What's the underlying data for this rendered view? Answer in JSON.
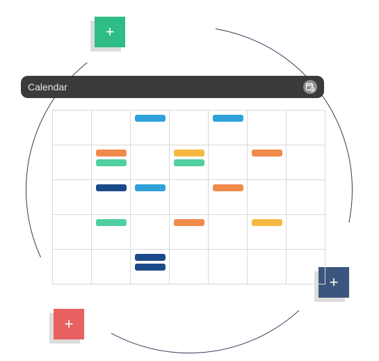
{
  "header": {
    "title": "Calendar",
    "icon": "calendar-add-icon"
  },
  "tiles": {
    "green": {
      "glyph": "+",
      "color": "#2ebd85",
      "shadow": "#9e9e9e"
    },
    "blue": {
      "glyph": "+",
      "color": "#3c557e",
      "shadow": "#9e9e9e"
    },
    "red": {
      "glyph": "+",
      "color": "#e86060",
      "shadow": "#9e9e9e"
    }
  },
  "colors": {
    "blue": "#2ea1d9",
    "green": "#4fd0a1",
    "orange": "#f08a4b",
    "darkblue": "#1b4a8a",
    "yellow": "#f5b941",
    "border": "#d9d9d9"
  },
  "grid": {
    "rows": 5,
    "cols": 7,
    "events": [
      {
        "r": 0,
        "c": 2,
        "color": "blue"
      },
      {
        "r": 0,
        "c": 4,
        "color": "blue"
      },
      {
        "r": 1,
        "c": 1,
        "color": "orange"
      },
      {
        "r": 1,
        "c": 1,
        "color": "green"
      },
      {
        "r": 1,
        "c": 3,
        "color": "yellow"
      },
      {
        "r": 1,
        "c": 3,
        "color": "green"
      },
      {
        "r": 1,
        "c": 5,
        "color": "orange"
      },
      {
        "r": 2,
        "c": 1,
        "color": "darkblue"
      },
      {
        "r": 2,
        "c": 2,
        "color": "blue"
      },
      {
        "r": 2,
        "c": 4,
        "color": "orange"
      },
      {
        "r": 3,
        "c": 1,
        "color": "green"
      },
      {
        "r": 3,
        "c": 3,
        "color": "orange"
      },
      {
        "r": 3,
        "c": 5,
        "color": "yellow"
      },
      {
        "r": 4,
        "c": 2,
        "color": "darkblue"
      },
      {
        "r": 4,
        "c": 2,
        "color": "darkblue"
      }
    ]
  }
}
